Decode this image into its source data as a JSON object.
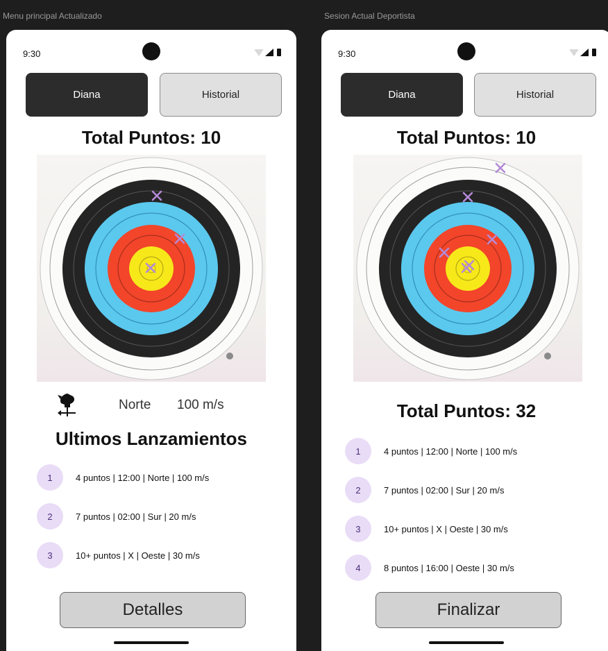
{
  "screens": [
    {
      "frame_label": "Menu principal Actualizado",
      "status_time": "9:30",
      "tabs": [
        "Diana",
        "Historial"
      ],
      "total_title": "Total Puntos: 10",
      "wind": {
        "direction": "Norte",
        "speed": "100 m/s"
      },
      "section_title": "Ultimos Lanzamientos",
      "throws": [
        {
          "num": "1",
          "text": "4 puntos | 12:00 | Norte | 100 m/s"
        },
        {
          "num": "2",
          "text": "7 puntos | 02:00 | Sur | 20 m/s"
        },
        {
          "num": "3",
          "text": "10+ puntos | X | Oeste | 30 m/s"
        }
      ],
      "button_label": "Detalles"
    },
    {
      "frame_label": "Sesion Actual Deportista",
      "status_time": "9:30",
      "tabs": [
        "Diana",
        "Historial"
      ],
      "total_title": "Total Puntos: 10",
      "total_title_2": "Total Puntos: 32",
      "throws": [
        {
          "num": "1",
          "text": "4 puntos | 12:00 | Norte | 100 m/s"
        },
        {
          "num": "2",
          "text": "7 puntos | 02:00 | Sur | 20 m/s"
        },
        {
          "num": "3",
          "text": "10+ puntos | X | Oeste | 30 m/s"
        },
        {
          "num": "4",
          "text": "8 puntos | 16:00 | Oeste | 30 m/s"
        }
      ],
      "button_label": "Finalizar"
    }
  ],
  "icons": [
    "wifi-icon",
    "signal-icon",
    "battery-icon",
    "weathervane-icon",
    "hit-marker-icon"
  ],
  "colors": {
    "target_gold": "#f7e81a",
    "target_red": "#f2452a",
    "target_blue": "#5bc8ee",
    "target_black": "#242424",
    "hit_marker": "#b48ad6",
    "badge_bg": "#e9dcf7"
  }
}
